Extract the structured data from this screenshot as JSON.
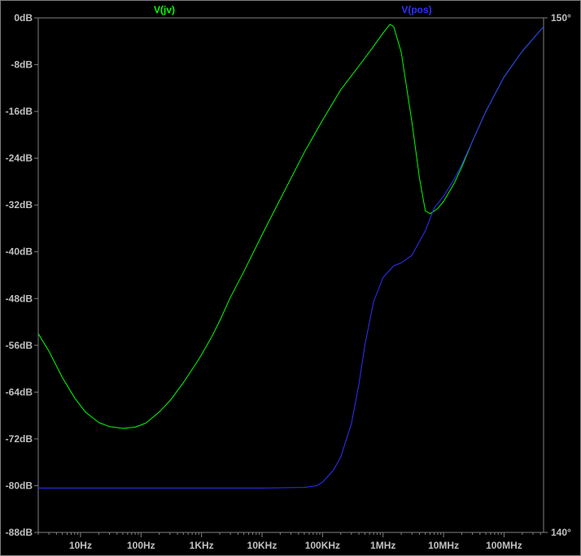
{
  "chart_data": {
    "type": "line",
    "x_scale": "log",
    "xlim": [
      2,
      450000000
    ],
    "ylim": [
      -88,
      0
    ],
    "y2lim": [
      140,
      150
    ],
    "x_ticks": [
      {
        "value": 10,
        "label": "10Hz"
      },
      {
        "value": 100,
        "label": "100Hz"
      },
      {
        "value": 1000,
        "label": "1KHz"
      },
      {
        "value": 10000,
        "label": "10KHz"
      },
      {
        "value": 100000,
        "label": "100KHz"
      },
      {
        "value": 1000000,
        "label": "1MHz"
      },
      {
        "value": 10000000,
        "label": "10MHz"
      },
      {
        "value": 100000000,
        "label": "100MHz"
      }
    ],
    "y_ticks": [
      {
        "value": 0,
        "label": "0dB"
      },
      {
        "value": -8,
        "label": "-8dB"
      },
      {
        "value": -16,
        "label": "-16dB"
      },
      {
        "value": -24,
        "label": "-24dB"
      },
      {
        "value": -32,
        "label": "-32dB"
      },
      {
        "value": -40,
        "label": "-40dB"
      },
      {
        "value": -48,
        "label": "-48dB"
      },
      {
        "value": -56,
        "label": "-56dB"
      },
      {
        "value": -64,
        "label": "-64dB"
      },
      {
        "value": -72,
        "label": "-72dB"
      },
      {
        "value": -80,
        "label": "-80dB"
      },
      {
        "value": -88,
        "label": "-88dB"
      }
    ],
    "y2_ticks": [
      {
        "value": 150,
        "label": "150°"
      },
      {
        "value": 140,
        "label": "140°"
      }
    ],
    "grid": false,
    "background": "#000000",
    "axis_color": "#808080",
    "series": [
      {
        "name": "V(jv)",
        "color": "#00ff00",
        "x": [
          2,
          3,
          5,
          8,
          12,
          20,
          30,
          50,
          80,
          120,
          200,
          300,
          500,
          800,
          1000,
          1500,
          2000,
          3000,
          5000,
          10000,
          20000,
          50000,
          100000,
          200000,
          500000,
          800000,
          1000000,
          1300000,
          1500000,
          2000000,
          3000000,
          4000000,
          5000000,
          6000000,
          8000000,
          10000000,
          15000000,
          20000000,
          30000000,
          50000000,
          100000000,
          200000000,
          450000000
        ],
        "y": [
          -54.0,
          -57.0,
          -61.5,
          -65.0,
          -67.4,
          -69.2,
          -69.9,
          -70.2,
          -70.0,
          -69.3,
          -67.4,
          -65.5,
          -62.4,
          -59.2,
          -57.6,
          -54.4,
          -51.8,
          -47.8,
          -43.4,
          -37.1,
          -31.0,
          -23.0,
          -17.5,
          -12.3,
          -6.9,
          -4.0,
          -2.6,
          -1.1,
          -1.5,
          -5.9,
          -17.8,
          -27.4,
          -33.0,
          -33.5,
          -32.6,
          -31.4,
          -28.3,
          -25.5,
          -21.1,
          -16.0,
          -10.1,
          -5.7,
          -1.5
        ]
      },
      {
        "name": "V(pos)",
        "color": "#3030ff",
        "x": [
          2,
          10,
          100,
          1000,
          10000,
          50000,
          80000,
          100000,
          150000,
          200000,
          300000,
          400000,
          500000,
          700000,
          1000000,
          1500000,
          2000000,
          3000000,
          5000000,
          7000000,
          10000000,
          15000000,
          20000000,
          30000000,
          50000000,
          100000000,
          200000000,
          450000000
        ],
        "y": [
          -80.4,
          -80.4,
          -80.4,
          -80.4,
          -80.4,
          -80.3,
          -80.0,
          -79.4,
          -77.4,
          -75.1,
          -69.4,
          -62.6,
          -56.0,
          -48.5,
          -44.4,
          -42.4,
          -41.9,
          -40.6,
          -36.4,
          -32.5,
          -30.5,
          -27.6,
          -25.1,
          -21.1,
          -16.0,
          -10.1,
          -5.7,
          -1.5
        ]
      }
    ]
  }
}
